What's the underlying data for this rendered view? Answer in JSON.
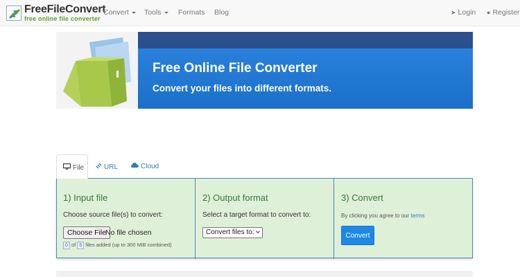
{
  "navbar": {
    "logo_title": "FreeFileConvert",
    "logo_tagline": "free online file converter",
    "items": [
      {
        "label": "Convert",
        "dropdown": true
      },
      {
        "label": "Tools",
        "dropdown": true
      },
      {
        "label": "Formats",
        "dropdown": false
      },
      {
        "label": "Blog",
        "dropdown": false
      }
    ],
    "login_label": "Login",
    "register_label": "Register"
  },
  "banner": {
    "title": "Free Online File Converter",
    "subtitle": "Convert your files into different formats."
  },
  "tabs": [
    {
      "label": "File",
      "icon": "monitor-icon",
      "active": true
    },
    {
      "label": "URL",
      "icon": "link-icon",
      "active": false
    },
    {
      "label": "Cloud",
      "icon": "cloud-icon",
      "active": false
    }
  ],
  "steps": {
    "input": {
      "heading": "1) Input file",
      "instruction": "Choose source file(s) to convert:",
      "file_button_label": "Choose File",
      "file_status": "No file chosen",
      "files_added": "0",
      "files_max": "5",
      "counter_of": "of",
      "counter_suffix": "files added (up to 300 MiB combined)"
    },
    "output": {
      "heading": "2) Output format",
      "instruction": "Select a target format to convert to:",
      "select_value": "Convert files to:"
    },
    "convert": {
      "heading": "3) Convert",
      "terms_prefix": "By clicking you agree to our",
      "terms_link": "terms",
      "button_label": "Convert"
    }
  },
  "colors": {
    "panel_bg": "#dff0d8",
    "panel_border": "#3c8dbc",
    "heading_green": "#3c763d",
    "link_blue": "#337ab7",
    "convert_button": "#1e88e5"
  }
}
